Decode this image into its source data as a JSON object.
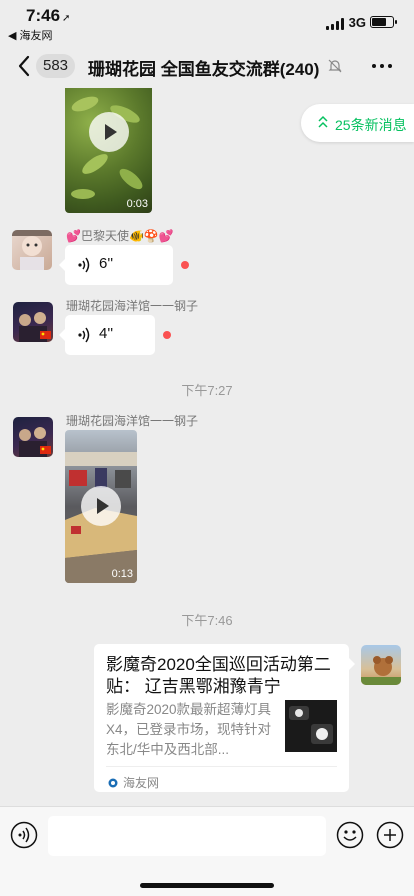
{
  "status_bar": {
    "time": "7:46",
    "back_app": "◀ 海友网",
    "network": "3G",
    "battery_level": 0.75
  },
  "nav": {
    "unread_count": "583",
    "title": "珊瑚花园 全国鱼友交流群(240)"
  },
  "new_messages": {
    "label": "25条新消息"
  },
  "messages": [
    {
      "type": "video",
      "duration": "0:03"
    },
    {
      "type": "voice",
      "sender": "💕巴黎天使🐠🍄💕",
      "seconds": "6''",
      "unread": true
    },
    {
      "type": "voice",
      "sender": "珊瑚花园海洋馆一一钢子",
      "seconds": "4''",
      "unread": true
    },
    {
      "type": "timestamp",
      "text": "下午7:27"
    },
    {
      "type": "video",
      "sender": "珊瑚花园海洋馆一一钢子",
      "duration": "0:13"
    },
    {
      "type": "timestamp",
      "text": "下午7:46"
    },
    {
      "type": "link_card",
      "title": "影魔奇2020全国巡回活动第二贴： 辽吉黑鄂湘豫青宁",
      "description": "影魔奇2020款最新超薄灯具X4，已登录市场，现特针对东北/华中及西北部...",
      "source": "海友网"
    }
  ],
  "colors": {
    "accent": "#07c160",
    "unread_dot": "#fa5151",
    "background": "#ededed"
  },
  "icons": {
    "voice_toggle": "voice-icon",
    "emoji": "emoji-icon",
    "plus": "plus-icon"
  }
}
